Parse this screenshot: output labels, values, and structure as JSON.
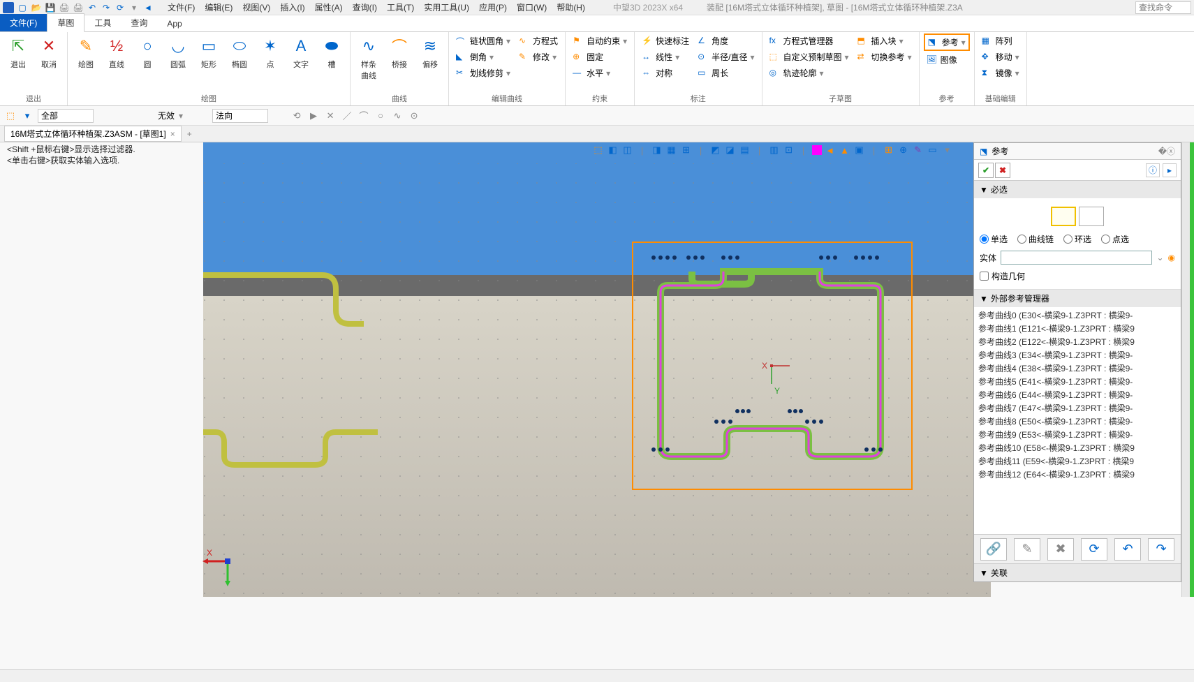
{
  "app": {
    "title_left": "中望3D 2023X x64",
    "title_right": "装配 [16M塔式立体循环种植架], 草图 - [16M塔式立体循环种植架.Z3A"
  },
  "qat": [
    "new",
    "open",
    "save",
    "print",
    "printpre",
    "undo",
    "redo",
    "refresh",
    "sep",
    "arrow"
  ],
  "menus": [
    "文件(F)",
    "编辑(E)",
    "视图(V)",
    "插入(I)",
    "属性(A)",
    "查询(I)",
    "工具(T)",
    "实用工具(U)",
    "应用(P)",
    "窗口(W)",
    "帮助(H)"
  ],
  "search_ph": "查找命令",
  "tabs": [
    {
      "label": "文件(F)",
      "active": true
    },
    {
      "label": "草图",
      "sel": true
    },
    {
      "label": "工具"
    },
    {
      "label": "查询"
    },
    {
      "label": "App"
    }
  ],
  "ribbon": {
    "g_exit": {
      "label": "退出",
      "items": [
        "退出",
        "取消"
      ]
    },
    "g_draw": {
      "label": "绘图",
      "items": [
        "绘图",
        "直线",
        "圆",
        "圆弧",
        "矩形",
        "椭圆",
        "点",
        "文字",
        "槽"
      ]
    },
    "g_curve": {
      "label": "曲线",
      "items": [
        "样条曲线",
        "桥接",
        "偏移"
      ]
    },
    "g_editcurve": {
      "label": "编辑曲线",
      "rows": [
        [
          "链状圆角",
          "方程式"
        ],
        [
          "倒角",
          "修改"
        ],
        [
          "划线修剪",
          ""
        ]
      ]
    },
    "g_constraint": {
      "label": "约束",
      "rows": [
        [
          "自动约束"
        ],
        [
          "固定"
        ],
        [
          "水平"
        ]
      ]
    },
    "g_dim": {
      "label": "标注",
      "rows": [
        [
          "快速标注",
          "角度"
        ],
        [
          "线性",
          "半径/直径"
        ],
        [
          "对称",
          "周长"
        ]
      ]
    },
    "g_sub": {
      "label": "子草图",
      "rows": [
        [
          "方程式管理器",
          "插入块"
        ],
        [
          "自定义预制草图",
          "切换参考"
        ],
        [
          "轨迹轮廓",
          ""
        ]
      ]
    },
    "g_ref": {
      "label": "参考",
      "rows": [
        [
          "参考"
        ],
        [
          "图像"
        ]
      ]
    },
    "g_basic": {
      "label": "基础编辑",
      "rows": [
        [
          "阵列"
        ],
        [
          "移动"
        ],
        [
          "镜像"
        ]
      ]
    }
  },
  "subbar": {
    "combo1": "全部",
    "label1": "无效",
    "combo2": "法向"
  },
  "doc_tab": "16M塔式立体循环种植架.Z3ASM - [草图1]",
  "hints": [
    "<Shift +鼠标右键>显示选择过滤器.",
    "<单击右键>获取实体输入选项."
  ],
  "axis": {
    "x": "X",
    "y": "Y"
  },
  "panel": {
    "title": "参考",
    "sec_required": "必选",
    "radios": [
      "单选",
      "曲线链",
      "环选",
      "点选"
    ],
    "radio_sel": 0,
    "entity_label": "实体",
    "construct": "构造几何",
    "sec_mgr": "外部参考管理器",
    "list": [
      "参考曲线0  (E30<-横梁9-1.Z3PRT : 横梁9-",
      "参考曲线1  (E121<-横梁9-1.Z3PRT : 横梁9",
      "参考曲线2  (E122<-横梁9-1.Z3PRT : 横梁9",
      "参考曲线3  (E34<-横梁9-1.Z3PRT : 横梁9-",
      "参考曲线4  (E38<-横梁9-1.Z3PRT : 横梁9-",
      "参考曲线5  (E41<-横梁9-1.Z3PRT : 横梁9-",
      "参考曲线6  (E44<-横梁9-1.Z3PRT : 横梁9-",
      "参考曲线7  (E47<-横梁9-1.Z3PRT : 横梁9-",
      "参考曲线8  (E50<-横梁9-1.Z3PRT : 横梁9-",
      "参考曲线9  (E53<-横梁9-1.Z3PRT : 横梁9-",
      "参考曲线10  (E58<-横梁9-1.Z3PRT : 横梁9",
      "参考曲线11  (E59<-横梁9-1.Z3PRT : 横梁9",
      "参考曲线12  (E64<-横梁9-1.Z3PRT : 横梁9"
    ],
    "sec_rel": "关联"
  }
}
